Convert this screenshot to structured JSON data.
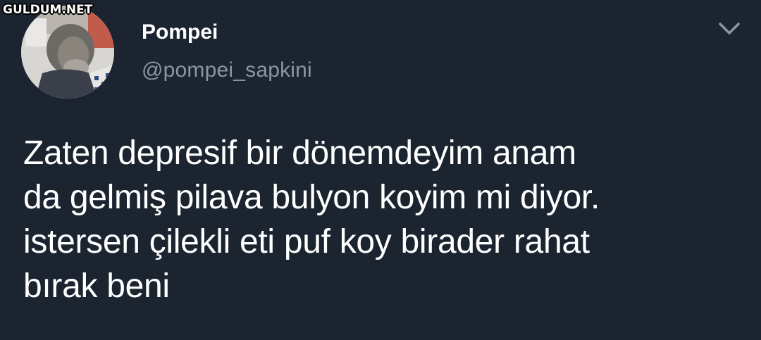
{
  "watermark": "GULDUM.NET",
  "user": {
    "display_name": "Pompei",
    "handle": "@pompei_sapkini",
    "avatar_icon": "user-avatar-photo"
  },
  "menu_icon": "chevron-down-icon",
  "tweet": {
    "text": "Zaten depresif bir dönemdeyim anam\nda gelmiş pilava bulyon koyim mi diyor.\nistersen çilekli eti puf koy birader rahat\nbırak beni"
  },
  "colors": {
    "background": "#1c2430",
    "primary_text": "#ffffff",
    "secondary_text": "#8a96a3"
  }
}
